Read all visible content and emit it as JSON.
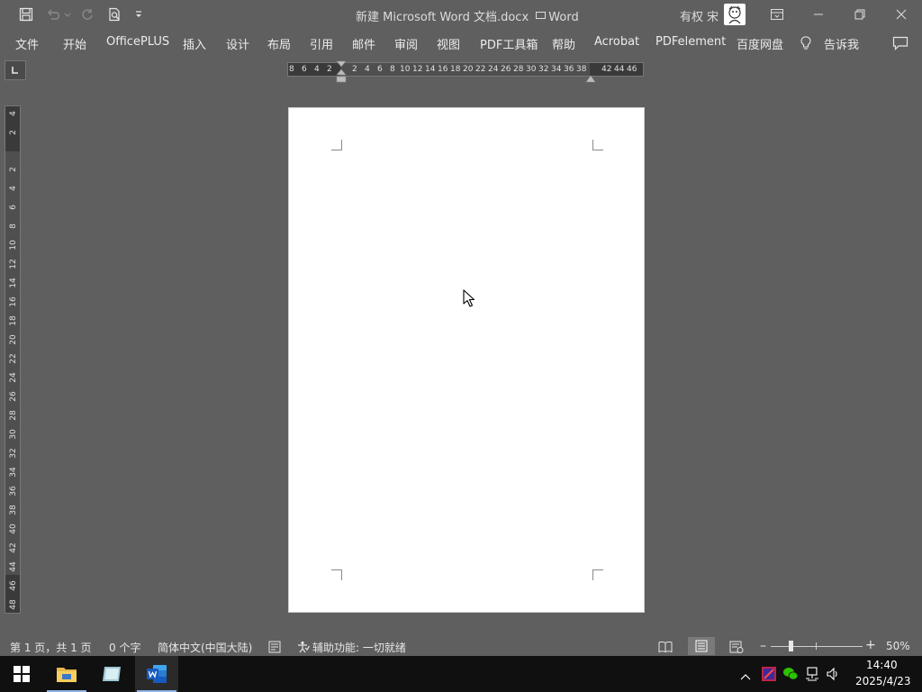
{
  "title_bar": {
    "document_title": "新建 Microsoft Word 文档.docx",
    "app_name": "Word",
    "user_name": "有权 宋",
    "icons": [
      "save-icon",
      "undo-icon",
      "redo-icon",
      "print-preview-icon",
      "customize-qat-icon",
      "ribbon-display-icon",
      "minimize-icon",
      "restore-icon",
      "close-icon"
    ]
  },
  "menu": {
    "items": [
      "文件",
      "开始",
      "OfficePLUS",
      "插入",
      "设计",
      "布局",
      "引用",
      "邮件",
      "审阅",
      "视图",
      "PDF工具箱",
      "帮助",
      "Acrobat",
      "PDFelement",
      "百度网盘"
    ],
    "tell_me": "告诉我"
  },
  "ruler": {
    "horizontal_left": [
      "8",
      "6",
      "4",
      "2"
    ],
    "horizontal_right": [
      "2",
      "4",
      "6",
      "8",
      "10",
      "12",
      "14",
      "16",
      "18",
      "20",
      "22",
      "24",
      "26",
      "28",
      "30",
      "32",
      "34",
      "36",
      "38",
      "42",
      "44",
      "46"
    ],
    "vertical": [
      "4",
      "2",
      "2",
      "4",
      "6",
      "8",
      "10",
      "12",
      "14",
      "16",
      "18",
      "20",
      "22",
      "24",
      "26",
      "28",
      "30",
      "32",
      "34",
      "36",
      "38",
      "40",
      "42",
      "44",
      "46",
      "48"
    ]
  },
  "status_bar": {
    "page_info": "第 1 页，共 1 页",
    "word_count": "0 个字",
    "language": "简体中文(中国大陆)",
    "accessibility": "辅助功能: 一切就绪",
    "zoom": "50%",
    "zoom_level": 0.5
  },
  "taskbar": {
    "apps": [
      "windows-start-icon",
      "file-explorer-icon",
      "notes-app-icon",
      "word-app-icon"
    ],
    "time": "14:40",
    "date": "2025/4/23"
  },
  "colors": {
    "background": "#5f5f5f",
    "page": "#ffffff",
    "taskbar": "#101010",
    "word_blue": "#2b579a"
  }
}
